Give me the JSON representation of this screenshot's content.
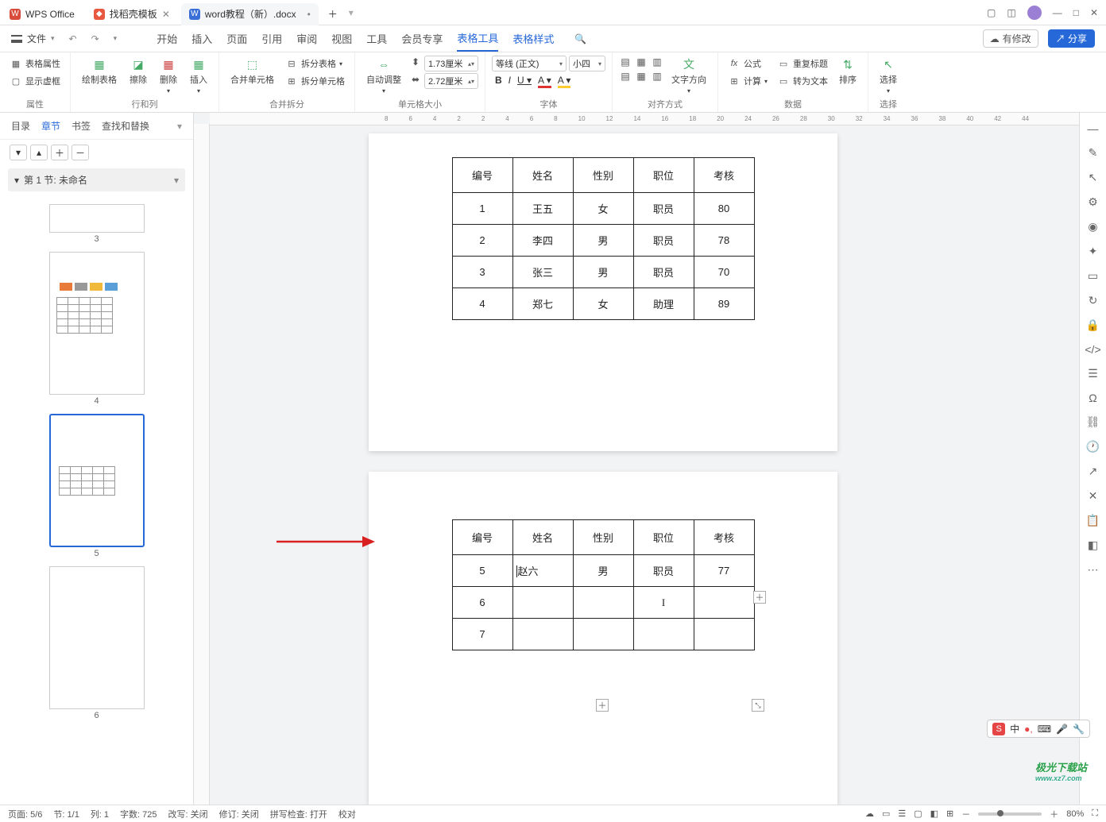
{
  "title": {
    "app": "WPS Office",
    "tab_template": "找稻壳模板",
    "doc_name": "word教程（新）.docx"
  },
  "titlebar_icons": [
    "□",
    "◫",
    "—",
    "□",
    "✕"
  ],
  "menubar": {
    "file": "文件",
    "items": [
      "开始",
      "插入",
      "页面",
      "引用",
      "审阅",
      "视图",
      "工具",
      "会员专享",
      "表格工具",
      "表格样式"
    ],
    "active_index": 8,
    "has_changes": "有修改",
    "share": "分享"
  },
  "ribbon": {
    "groups": [
      {
        "label": "属性",
        "buttons": [
          "表格属性",
          "显示虚框"
        ]
      },
      {
        "label": "行和列",
        "buttons": [
          "绘制表格",
          "擦除",
          "删除",
          "插入"
        ]
      },
      {
        "label": "合并拆分",
        "buttons": [
          "合并单元格",
          "拆分表格",
          "拆分单元格"
        ]
      },
      {
        "label": "单元格大小",
        "buttons": [
          "自动调整"
        ],
        "width": "1.73厘米",
        "height": "2.72厘米"
      },
      {
        "label": "字体",
        "font": "等线 (正文)",
        "size": "小四"
      },
      {
        "label": "对齐方式",
        "text_dir": "文字方向"
      },
      {
        "label": "数据",
        "buttons": [
          "公式",
          "计算",
          "重复标题",
          "转为文本",
          "排序"
        ]
      },
      {
        "label": "选择",
        "buttons": [
          "选择"
        ]
      }
    ]
  },
  "leftpanel": {
    "tabs": [
      "目录",
      "章节",
      "书签",
      "查找和替换"
    ],
    "active_tab": 1,
    "section_title": "第 1 节: 未命名",
    "thumb_labels": [
      "3",
      "4",
      "5",
      "6"
    ],
    "selected_thumb": 2
  },
  "ruler_marks": [
    "8",
    "6",
    "4",
    "2",
    "",
    "",
    "",
    "2",
    "4",
    "6",
    "8",
    "10",
    "12",
    "14",
    "16",
    "18",
    "20",
    "",
    "24",
    "26",
    "28",
    "30",
    "32",
    "34",
    "36",
    "38",
    "40",
    "42",
    "44"
  ],
  "table1": {
    "headers": [
      "编号",
      "姓名",
      "性别",
      "职位",
      "考核"
    ],
    "rows": [
      [
        "1",
        "王五",
        "女",
        "职员",
        "80"
      ],
      [
        "2",
        "李四",
        "男",
        "职员",
        "78"
      ],
      [
        "3",
        "张三",
        "男",
        "职员",
        "70"
      ],
      [
        "4",
        "郑七",
        "女",
        "助理",
        "89"
      ]
    ]
  },
  "table2": {
    "headers": [
      "编号",
      "姓名",
      "性别",
      "职位",
      "考核"
    ],
    "rows": [
      [
        "5",
        "赵六",
        "男",
        "职员",
        "77"
      ],
      [
        "6",
        "",
        "",
        "",
        ""
      ],
      [
        "7",
        "",
        "",
        "",
        ""
      ]
    ]
  },
  "statusbar": {
    "page": "页面: 5/6",
    "section": "节: 1/1",
    "col": "列: 1",
    "words": "字数: 725",
    "track": "改写: 关闭",
    "revise": "修订: 关闭",
    "spell": "拼写检查: 打开",
    "proof": "校对",
    "zoom": "80%"
  },
  "watermark": {
    "main": "极光下载站",
    "sub": "www.xz7.com"
  },
  "ime": {
    "lang": "中"
  }
}
